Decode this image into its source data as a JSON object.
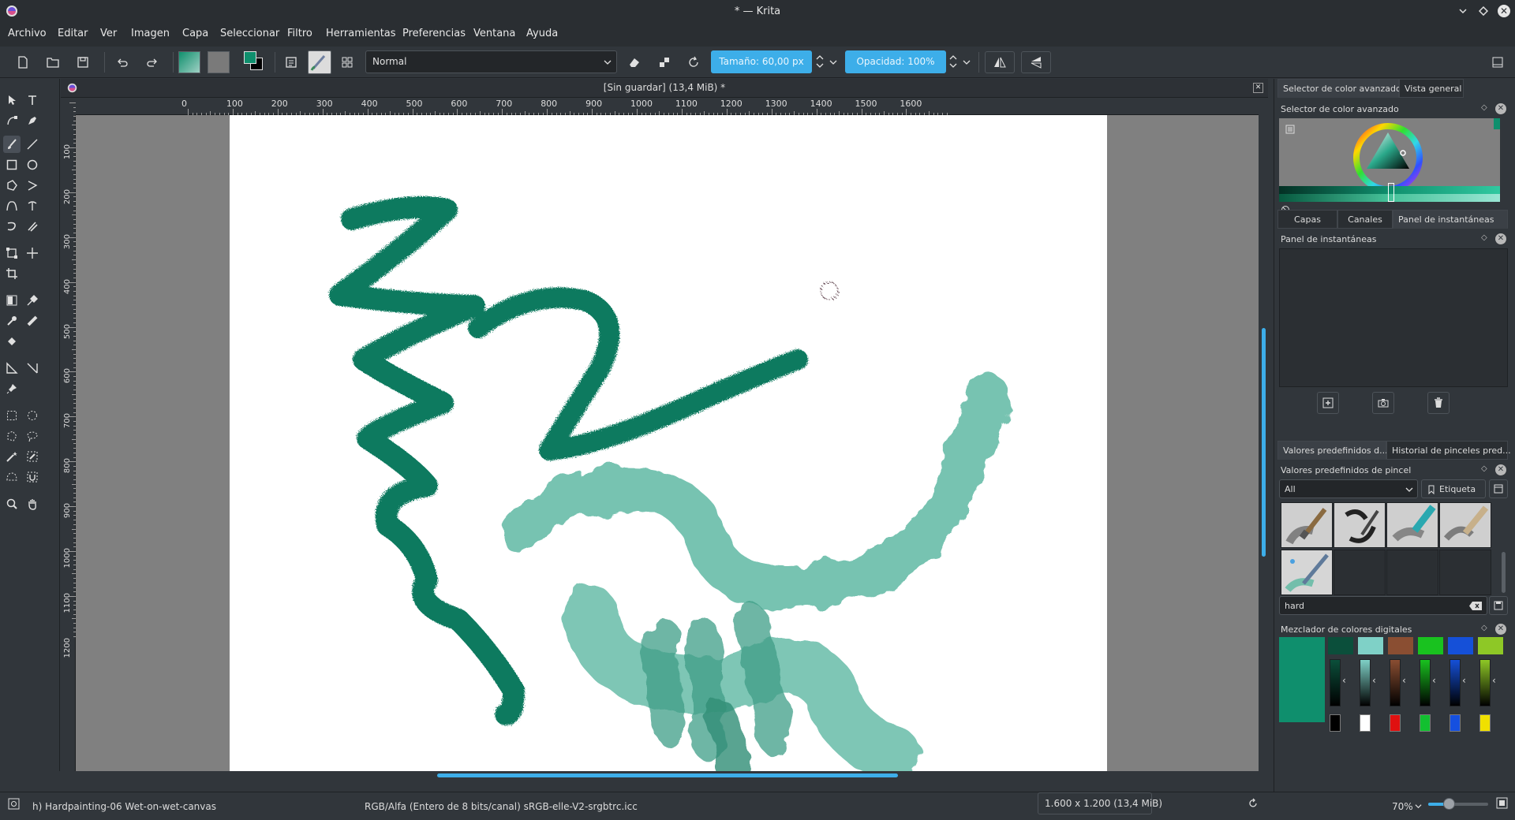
{
  "window": {
    "title": "* — Krita"
  },
  "menu": [
    "Archivo",
    "Editar",
    "Ver",
    "Imagen",
    "Capa",
    "Seleccionar",
    "Filtro",
    "Herramientas",
    "Preferencias",
    "Ventana",
    "Ayuda"
  ],
  "toolbar": {
    "blend_mode": "Normal",
    "size_label": "Tamaño: 60,00 px",
    "opacity_label": "Opacidad: 100%"
  },
  "document": {
    "tab_title": "[Sin guardar]  (13,4 MiB) *",
    "h_ruler_ticks": [
      "0",
      "100",
      "200",
      "300",
      "400",
      "500",
      "600",
      "700",
      "800",
      "900",
      "1000",
      "1100",
      "1200",
      "1300",
      "1400",
      "1500",
      "1600"
    ],
    "v_ruler_ticks": [
      "100",
      "200",
      "300",
      "400",
      "500",
      "600",
      "700",
      "800",
      "900",
      "1000",
      "1100",
      "1200"
    ]
  },
  "status": {
    "brush": "h) Hardpainting-06 Wet-on-wet-canvas",
    "color_space": "RGB/Alfa (Entero de 8 bits/canal)  sRGB-elle-V2-srgbtrc.icc",
    "dimensions": "1.600 x 1.200 (13,4 MiB)",
    "zoom": "70%"
  },
  "dock": {
    "top_tabs": [
      "Selector de color avanzado",
      "Vista general"
    ],
    "color_selector_title": "Selector de color avanzado",
    "mid_tabs": [
      "Capas",
      "Canales",
      "Panel de instantáneas"
    ],
    "snapshot_title": "Panel de instantáneas",
    "preset_tabs": [
      "Valores predefinidos d...",
      "Historial de pinceles pred..."
    ],
    "preset_title": "Valores predefinidos de pincel",
    "preset_filter": "All",
    "preset_tag_button": "Etiqueta",
    "preset_search": "hard",
    "mixer_title": "Mezclador de colores digitales"
  },
  "colors": {
    "accent": "#3daee9",
    "foreground_color": "#0f8f6d",
    "stroke_dark": "#0d7a5f",
    "stroke_light": "#68bca8",
    "mixer_swatches": [
      "#0b4f3b",
      "#7fd1c7",
      "#8a4e32",
      "#19c21f",
      "#1550d8",
      "#8ec826"
    ],
    "mixer_dots": [
      "#000000",
      "#ffffff",
      "#e01010",
      "#12c030",
      "#1550e0",
      "#f0e000"
    ]
  }
}
